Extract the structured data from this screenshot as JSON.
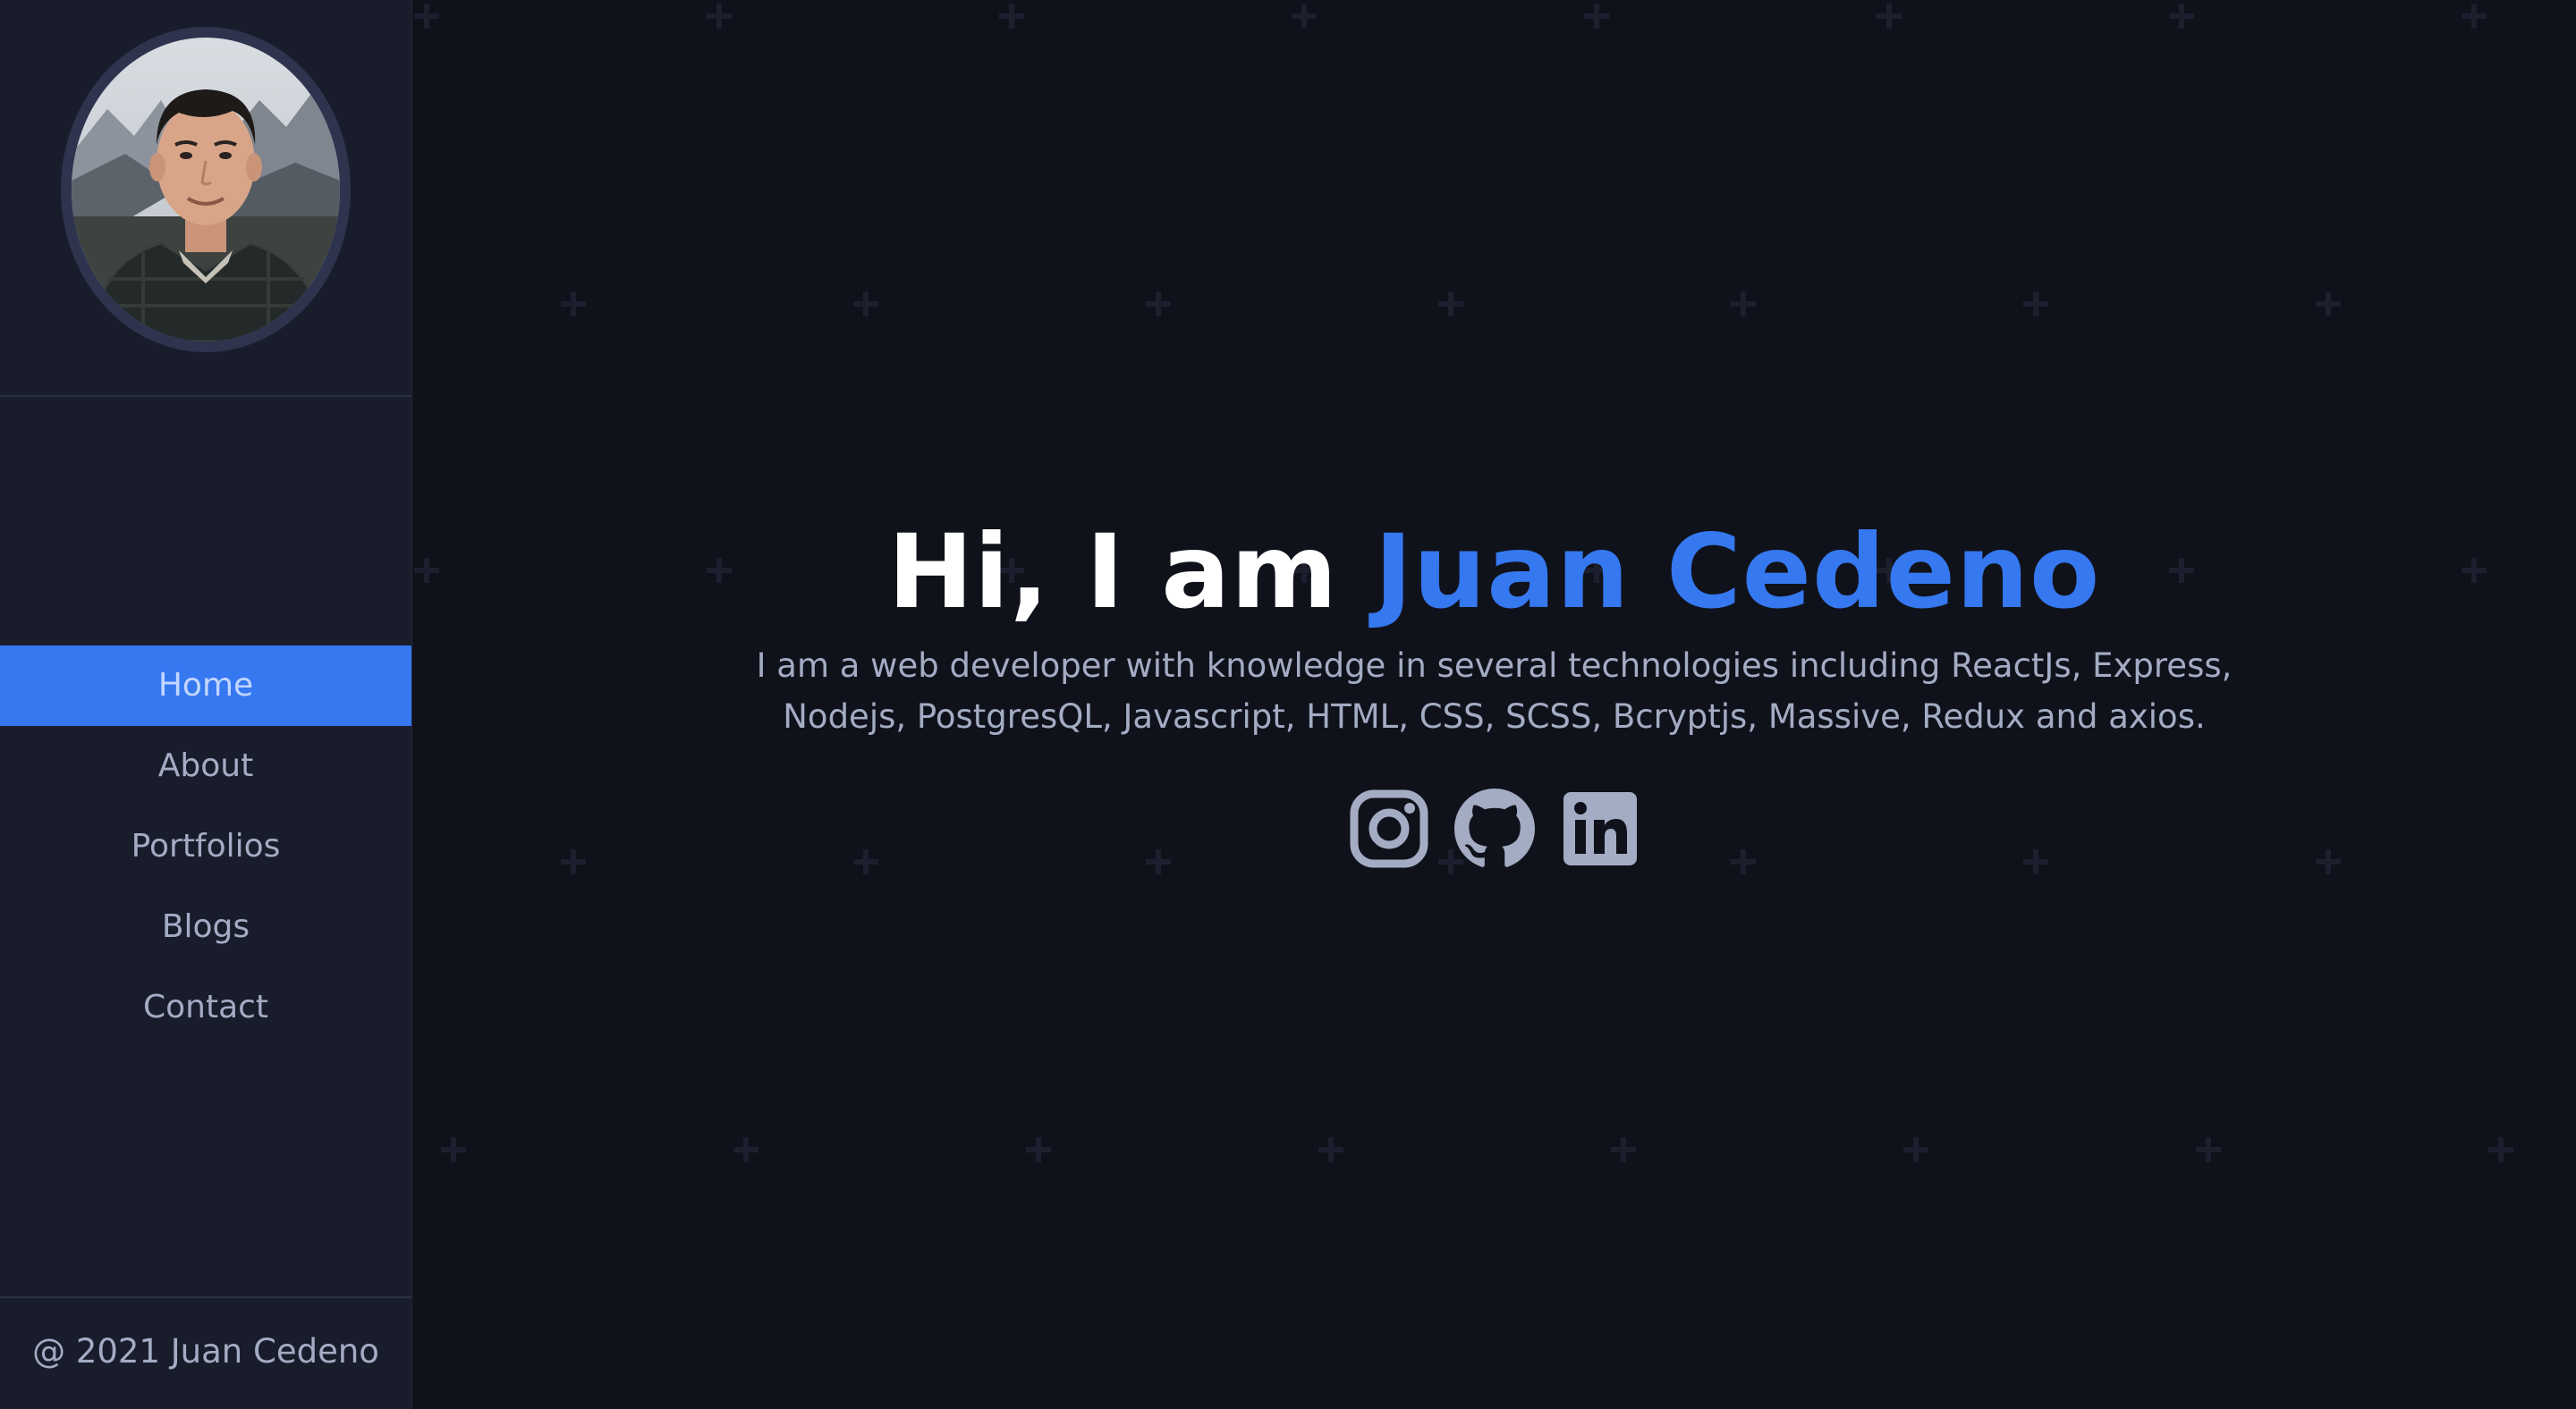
{
  "sidebar": {
    "nav": [
      {
        "label": "Home",
        "active": true
      },
      {
        "label": "About"
      },
      {
        "label": "Portfolios"
      },
      {
        "label": "Blogs"
      },
      {
        "label": "Contact"
      }
    ],
    "copyright": "@ 2021 Juan Cedeno"
  },
  "hero": {
    "greeting": "Hi, I am",
    "name": "Juan Cedeno",
    "description": "I am a web developer with knowledge in several technologies including ReactJs, Express, Nodejs, PostgresQL, Javascript, HTML, CSS, SCSS, Bcryptjs, Massive, Redux and axios."
  },
  "socials": [
    {
      "icon": "instagram-icon"
    },
    {
      "icon": "github-icon"
    },
    {
      "icon": "linkedin-icon"
    }
  ],
  "colors": {
    "background": "#10121b",
    "sidebar": "#191d2b",
    "accent": "#3578f0",
    "text": "#a4acc4",
    "heading": "#ffffff"
  }
}
